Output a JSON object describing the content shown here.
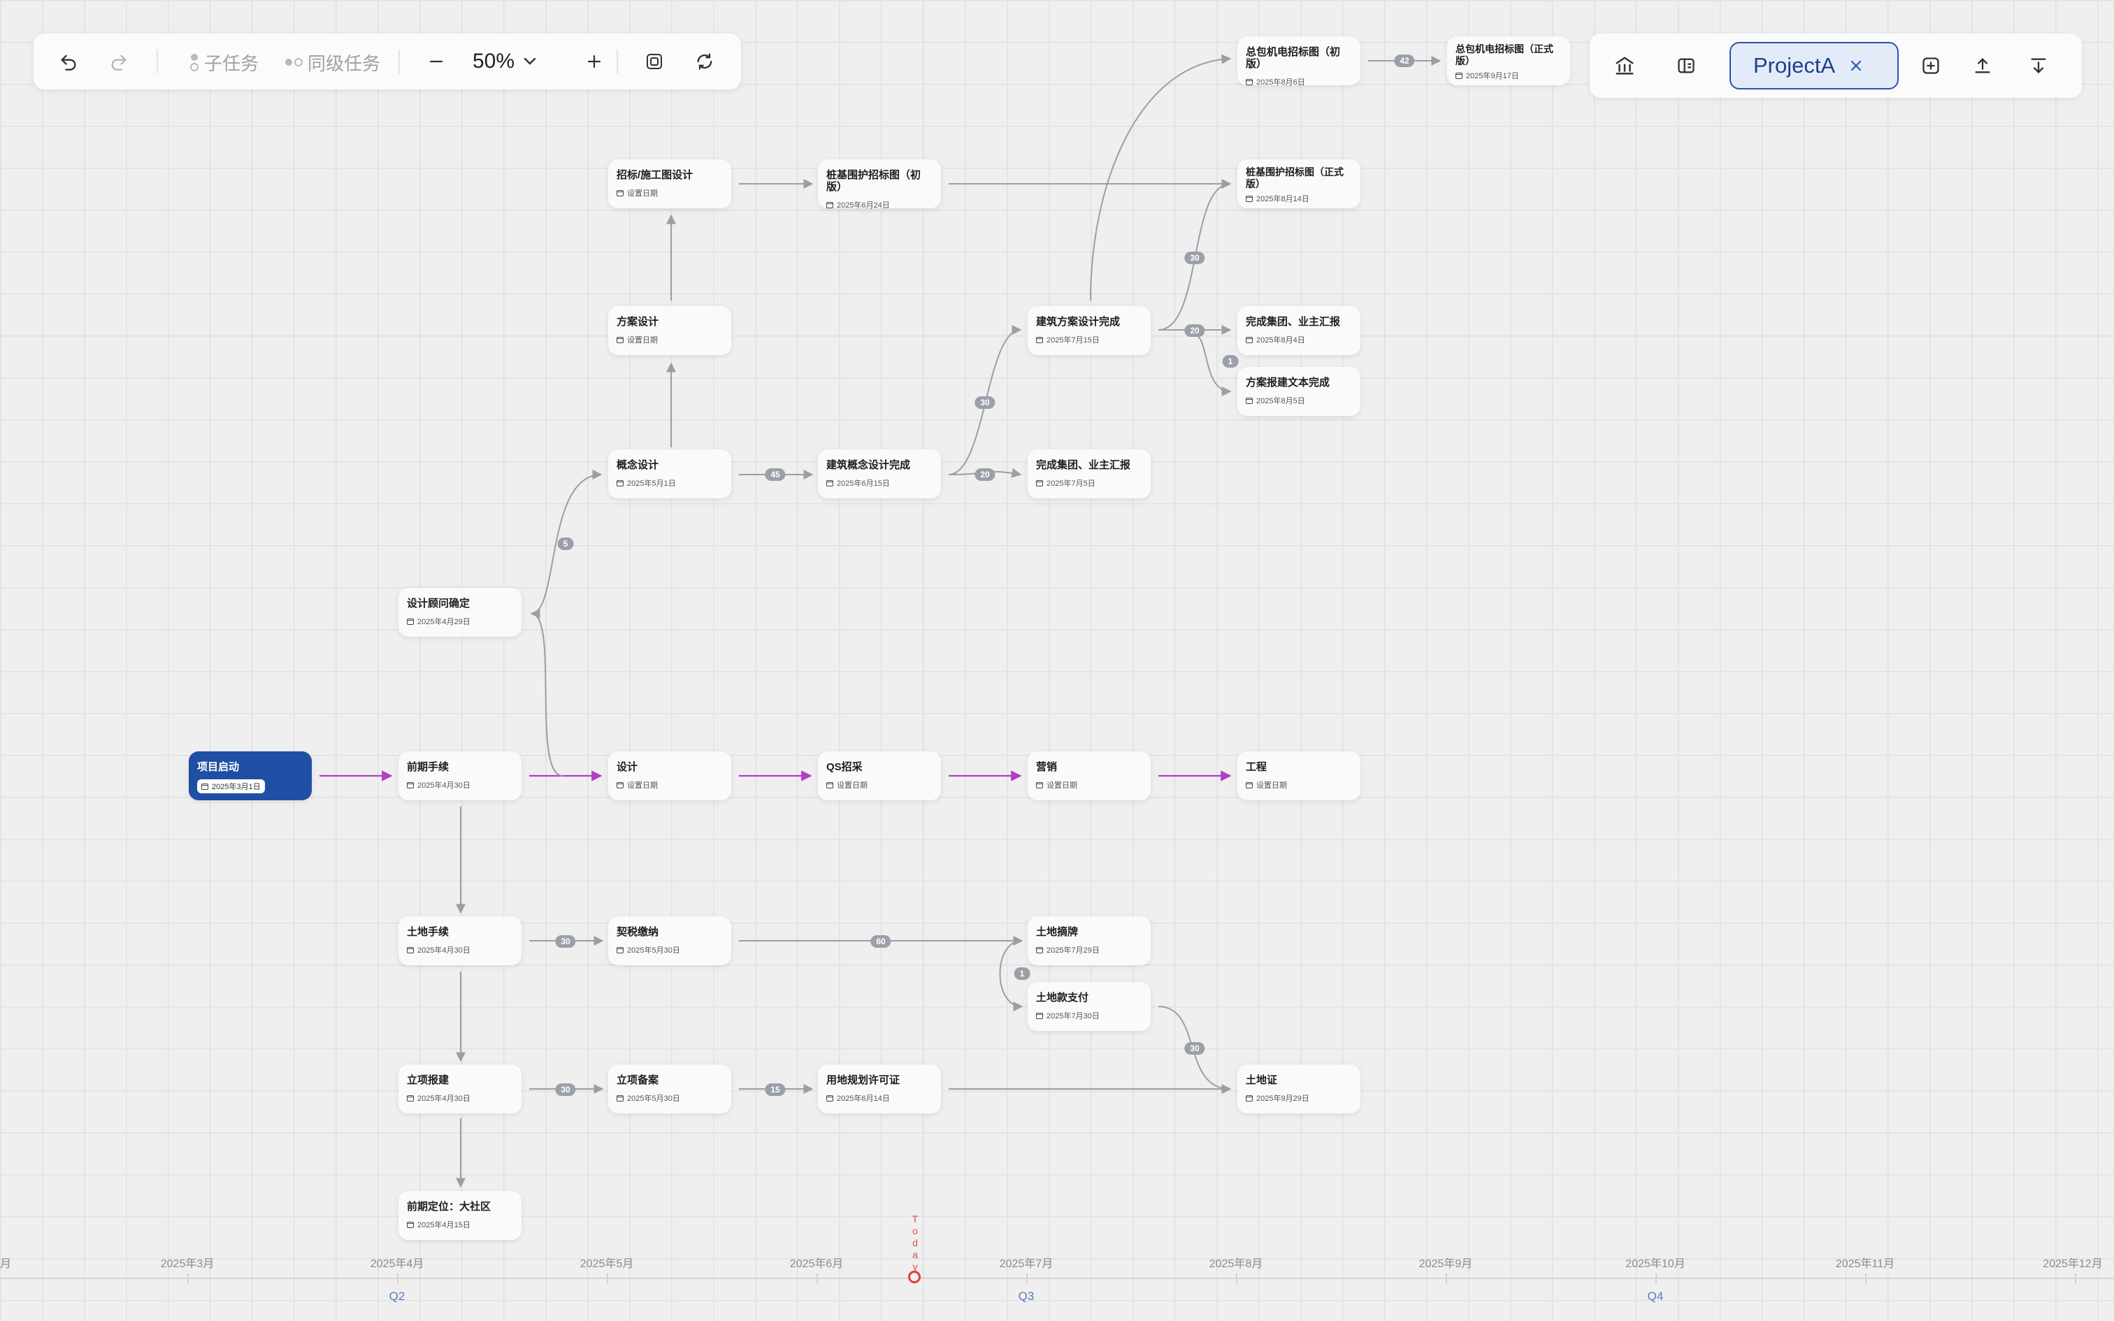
{
  "toolbar": {
    "subtask_label": "子任务",
    "sibling_label": "同级任务",
    "zoom": "50%"
  },
  "right_toolbar": {
    "project_name": "ProjectA"
  },
  "nodes": {
    "n1": {
      "title": "项目启动",
      "date": "2025年3月1日"
    },
    "n2": {
      "title": "前期手续",
      "date": "2025年4月30日"
    },
    "n3": {
      "title": "设计",
      "date": "设置日期"
    },
    "n4": {
      "title": "QS招采",
      "date": "设置日期"
    },
    "n5": {
      "title": "营销",
      "date": "设置日期"
    },
    "n6": {
      "title": "工程",
      "date": "设置日期"
    },
    "n7": {
      "title": "设计顾问确定",
      "date": "2025年4月29日"
    },
    "n8": {
      "title": "概念设计",
      "date": "2025年5月1日"
    },
    "n9": {
      "title": "方案设计",
      "date": "设置日期"
    },
    "n10": {
      "title": "招标/施工图设计",
      "date": "设置日期"
    },
    "n11": {
      "title": "桩基围护招标图（初版）",
      "date": "2025年6月24日"
    },
    "n12": {
      "title": "建筑概念设计完成",
      "date": "2025年6月15日"
    },
    "n13": {
      "title": "完成集团、业主汇报",
      "date": "2025年7月5日"
    },
    "n14": {
      "title": "建筑方案设计完成",
      "date": "2025年7月15日"
    },
    "n15": {
      "title": "总包机电招标图（初版）",
      "date": "2025年8月6日"
    },
    "n16": {
      "title": "总包机电招标图（正式版）",
      "date": "2025年9月17日"
    },
    "n17": {
      "title": "桩基围护招标图（正式版）",
      "date": "2025年8月14日"
    },
    "n18": {
      "title": "完成集团、业主汇报",
      "date": "2025年8月4日"
    },
    "n19": {
      "title": "方案报建文本完成",
      "date": "2025年8月5日"
    },
    "n20": {
      "title": "土地手续",
      "date": "2025年4月30日"
    },
    "n21": {
      "title": "契税缴纳",
      "date": "2025年5月30日"
    },
    "n22": {
      "title": "土地摘牌",
      "date": "2025年7月29日"
    },
    "n23": {
      "title": "土地款支付",
      "date": "2025年7月30日"
    },
    "n24": {
      "title": "立项报建",
      "date": "2025年4月30日"
    },
    "n25": {
      "title": "立项备案",
      "date": "2025年5月30日"
    },
    "n26": {
      "title": "用地规划许可证",
      "date": "2025年6月14日"
    },
    "n27": {
      "title": "土地证",
      "date": "2025年9月29日"
    },
    "n28": {
      "title": "前期定位：大社区",
      "date": "2025年4月15日"
    }
  },
  "edge_labels": [
    "5",
    "45",
    "20",
    "30",
    "30",
    "20",
    "1",
    "42",
    "30",
    "60",
    "1",
    "30",
    "30",
    "15"
  ],
  "timeline": {
    "months": [
      "月",
      "2025年3月",
      "2025年4月",
      "2025年5月",
      "2025年6月",
      "2025年7月",
      "2025年8月",
      "2025年9月",
      "2025年10月",
      "2025年11月",
      "2025年12月"
    ],
    "quarters": [
      "Q2",
      "Q3",
      "Q4"
    ],
    "today": "Today"
  }
}
